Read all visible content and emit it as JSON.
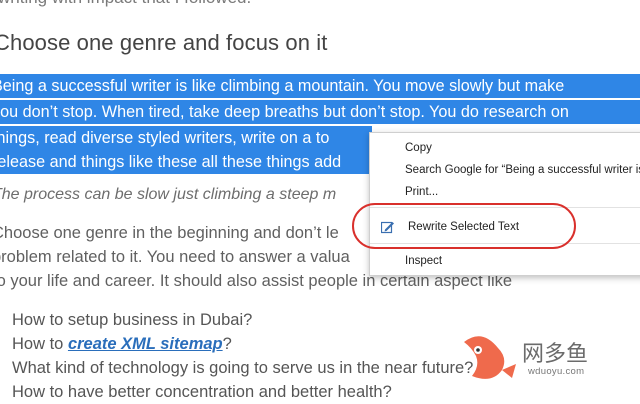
{
  "article": {
    "top_line": "writing with impact that I followed.",
    "heading": "Choose one genre and focus on it",
    "selected_lines": [
      "Being a successful writer is like climbing a mountain. You move slowly but make",
      "you don’t stop. When tired, take deep breaths but don’t stop. You do research on",
      "things, read diverse styled writers, write on a to",
      "release and things like these all these things add"
    ],
    "italic_line": "The process can be slow just climbing a steep m",
    "paragraph_lines": [
      "Choose one genre in the beginning and don’t le",
      "problem related to it. You need to answer a valua",
      "to your life and career. It should also assist people in certain aspect like"
    ],
    "list": {
      "item1": "How to setup business in Dubai?",
      "item2_prefix": "How to ",
      "item2_link": "create XML sitemap",
      "item2_suffix": "?",
      "item3": "What kind of technology is going to serve us in the near future?",
      "item4": "How to have better concentration and better health?"
    }
  },
  "context_menu": {
    "copy": "Copy",
    "search_google": "Search Google for “Being a successful writer is like climbing a mountain…”",
    "print": "Print...",
    "rewrite": "Rewrite Selected Text",
    "inspect": "Inspect"
  },
  "watermark": {
    "name": "网多鱼",
    "domain": "wduoyu.com"
  },
  "colors": {
    "selection": "#2f86e6",
    "highlight_oval": "#d9302c",
    "link": "#2a6ebb",
    "fish_logo": "#ef6a4c"
  }
}
